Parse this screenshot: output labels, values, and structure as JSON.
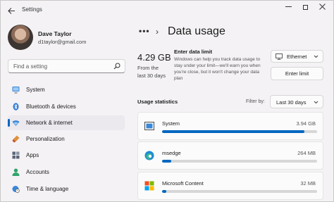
{
  "window": {
    "title": "Settings"
  },
  "user": {
    "name": "Dave Taylor",
    "email": "d1taylor@gmail.com"
  },
  "search": {
    "placeholder": "Find a setting"
  },
  "sidebar": {
    "items": [
      {
        "label": "System",
        "icon": "monitor-icon",
        "active": false
      },
      {
        "label": "Bluetooth & devices",
        "icon": "bluetooth-icon",
        "active": false
      },
      {
        "label": "Network & internet",
        "icon": "wifi-icon",
        "active": true
      },
      {
        "label": "Personalization",
        "icon": "brush-icon",
        "active": false
      },
      {
        "label": "Apps",
        "icon": "apps-icon",
        "active": false
      },
      {
        "label": "Accounts",
        "icon": "person-icon",
        "active": false
      },
      {
        "label": "Time & language",
        "icon": "globe-clock-icon",
        "active": false
      }
    ]
  },
  "header": {
    "more": "•••",
    "separator": "›",
    "title": "Data usage"
  },
  "summary": {
    "value": "4.29 GB",
    "period_line1": "From the",
    "period_line2": "last 30 days"
  },
  "limit": {
    "title": "Enter data limit",
    "description": "Windows can help you track data usage to stay under your limit—we'll warn you when you're close, but it won't change your data plan",
    "button": "Enter limit"
  },
  "network": {
    "selected": "Ethernet",
    "icon": "ethernet-icon"
  },
  "stats": {
    "label": "Usage statistics",
    "filter_label": "Filter by:",
    "filter_value": "Last 30 days"
  },
  "apps": [
    {
      "name": "System",
      "size": "3.94 GB",
      "usage_fraction": 0.92,
      "icon": "system-app-icon"
    },
    {
      "name": "msedge",
      "size": "264 MB",
      "usage_fraction": 0.06,
      "icon": "edge-icon"
    },
    {
      "name": "Microsoft Content",
      "size": "32 MB",
      "usage_fraction": 0.01,
      "icon": "microsoft-logo-icon"
    }
  ],
  "colors": {
    "accent": "#0067c0",
    "background": "#f4f2f5"
  }
}
